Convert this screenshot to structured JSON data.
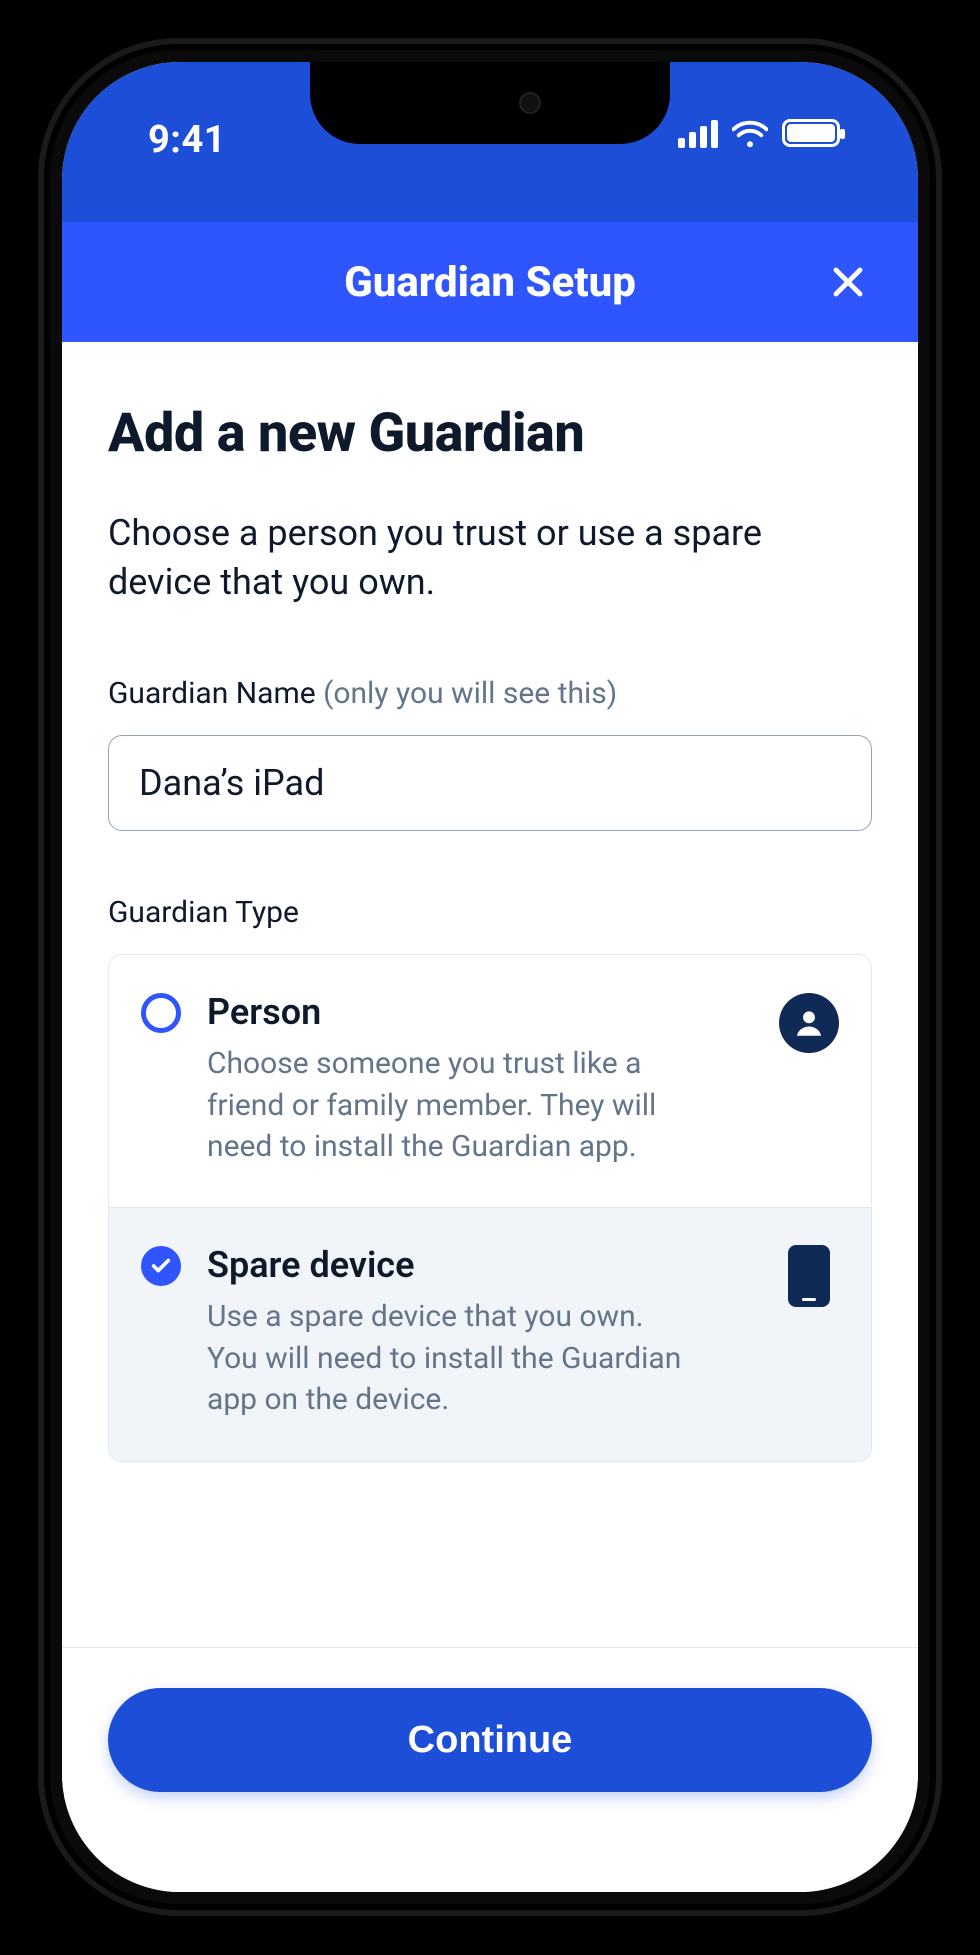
{
  "status": {
    "time": "9:41"
  },
  "nav": {
    "title": "Guardian Setup"
  },
  "page": {
    "title": "Add a new Guardian",
    "subtitle": "Choose a person you trust or use a spare device that you own."
  },
  "nameField": {
    "label": "Guardian Name ",
    "hint": "(only you will see this)",
    "value": "Dana’s iPad"
  },
  "typeField": {
    "label": "Guardian Type",
    "options": [
      {
        "id": "person",
        "title": "Person",
        "desc": "Choose someone you trust like a friend or family member. They will need to install the Guardian app.",
        "selected": false
      },
      {
        "id": "spare",
        "title": "Spare device",
        "desc": "Use a spare device that you own. You will need to install the Guardian app on the device.",
        "selected": true
      }
    ]
  },
  "footer": {
    "continue": "Continue"
  }
}
